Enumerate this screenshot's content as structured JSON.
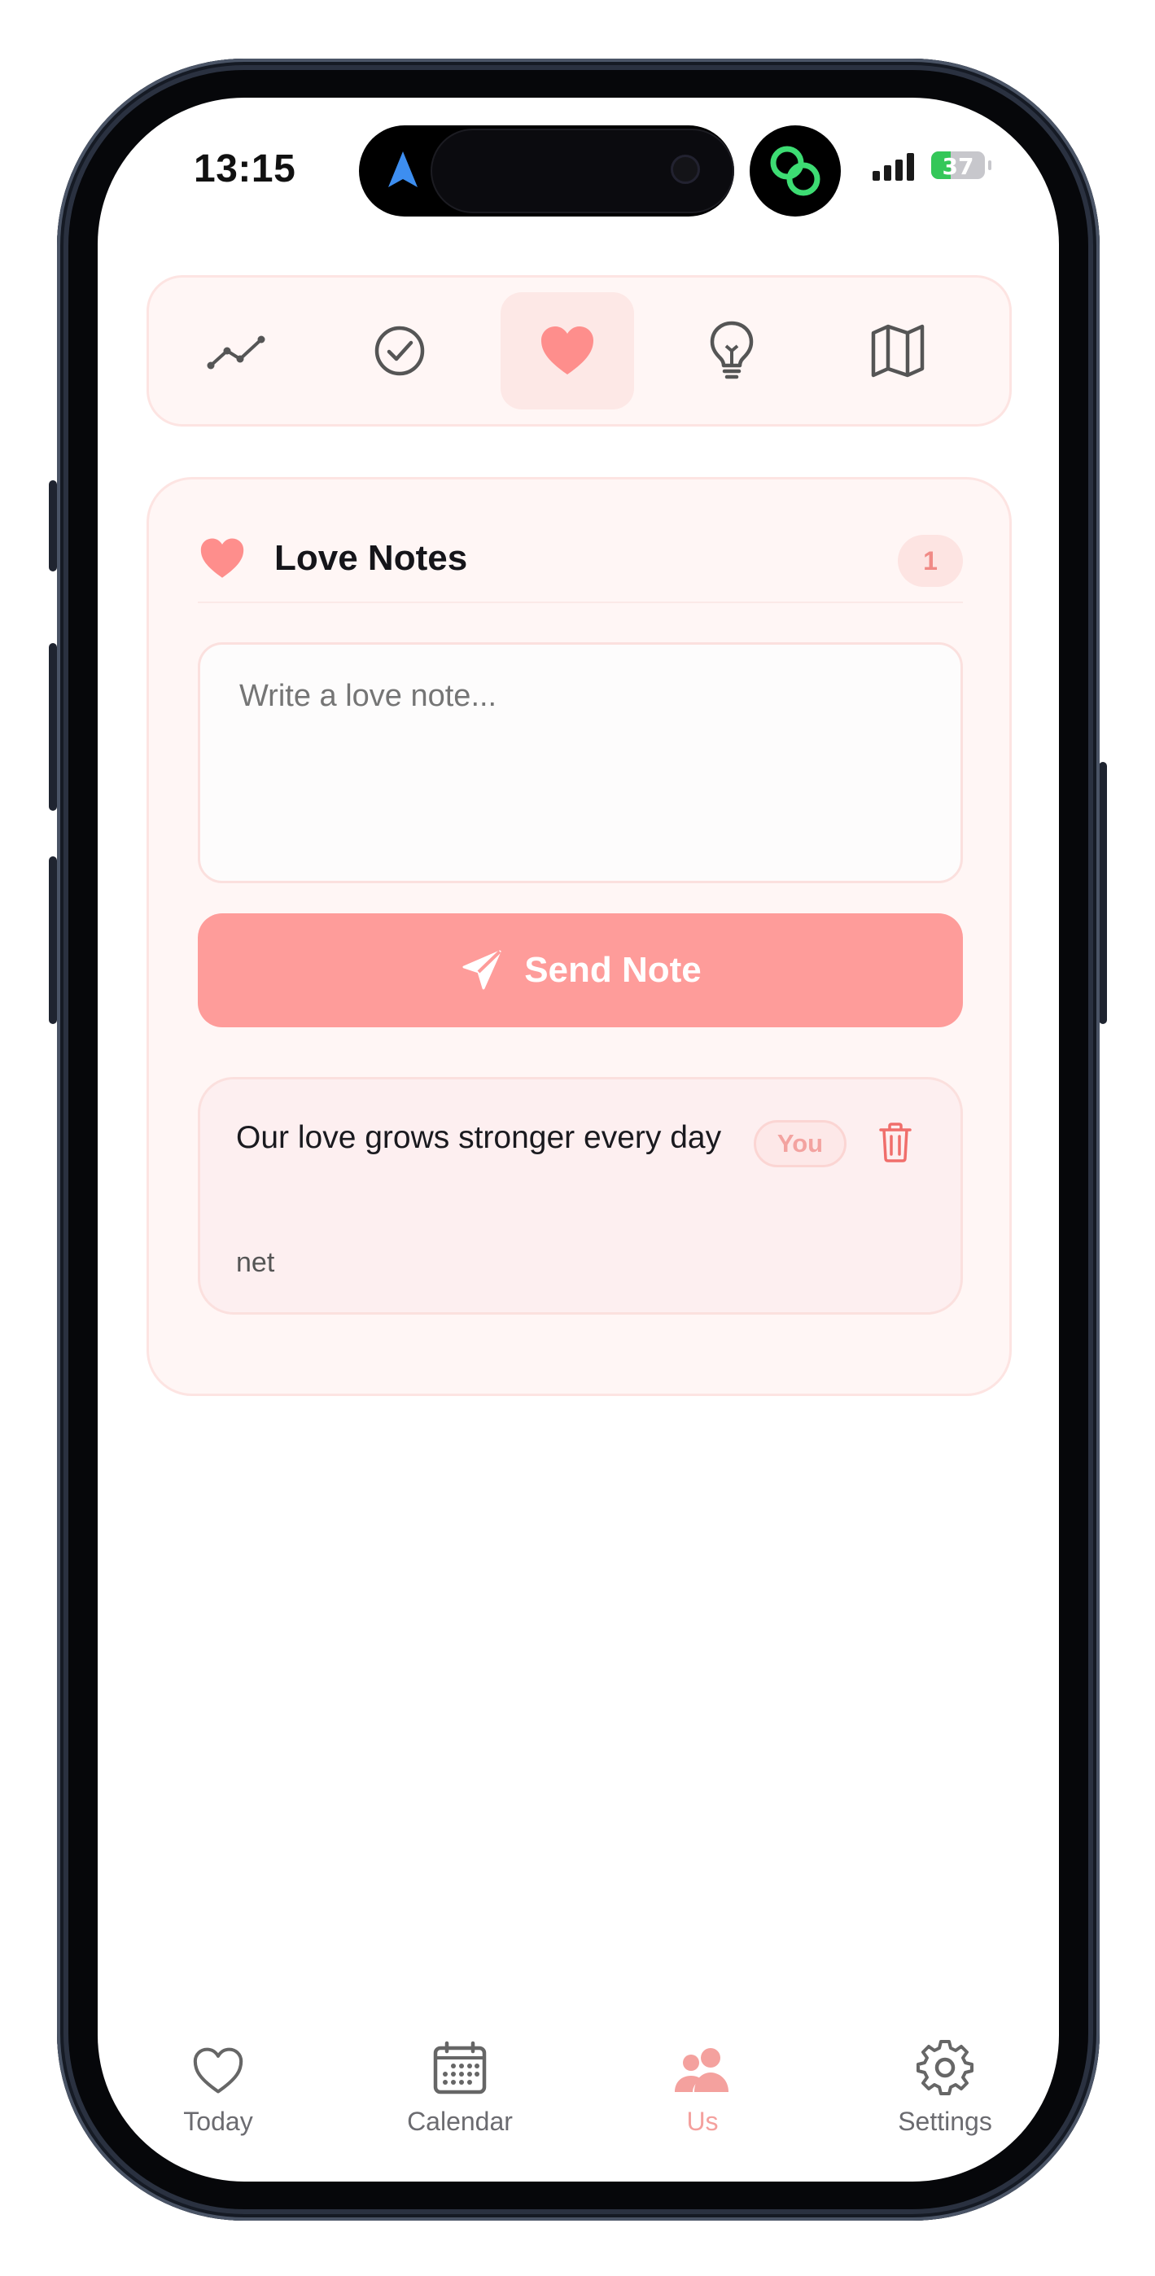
{
  "status_bar": {
    "time": "13:15",
    "battery_level": 37,
    "battery_text": "37",
    "battery_color": "#34c759"
  },
  "toolbar": {
    "items": [
      {
        "icon": "trend-line-icon",
        "active": false
      },
      {
        "icon": "check-circle-icon",
        "active": false
      },
      {
        "icon": "heart-icon",
        "active": true
      },
      {
        "icon": "lightbulb-icon",
        "active": false
      },
      {
        "icon": "map-icon",
        "active": false
      }
    ]
  },
  "love_notes": {
    "title": "Love Notes",
    "count": "1",
    "input_placeholder": "Write a love note...",
    "send_label": "Send Note",
    "notes": [
      {
        "text": "Our love grows stronger every day",
        "author_badge": "You",
        "author": "net"
      }
    ]
  },
  "tabbar": {
    "items": [
      {
        "label": "Today",
        "icon": "heart-outline-icon",
        "active": false
      },
      {
        "label": "Calendar",
        "icon": "calendar-icon",
        "active": false
      },
      {
        "label": "Us",
        "icon": "people-icon",
        "active": true
      },
      {
        "label": "Settings",
        "icon": "gear-icon",
        "active": false
      }
    ]
  },
  "colors": {
    "accent": "#fe9c9a",
    "accent_soft": "#fde8e6",
    "card_bg": "#fff6f5"
  }
}
